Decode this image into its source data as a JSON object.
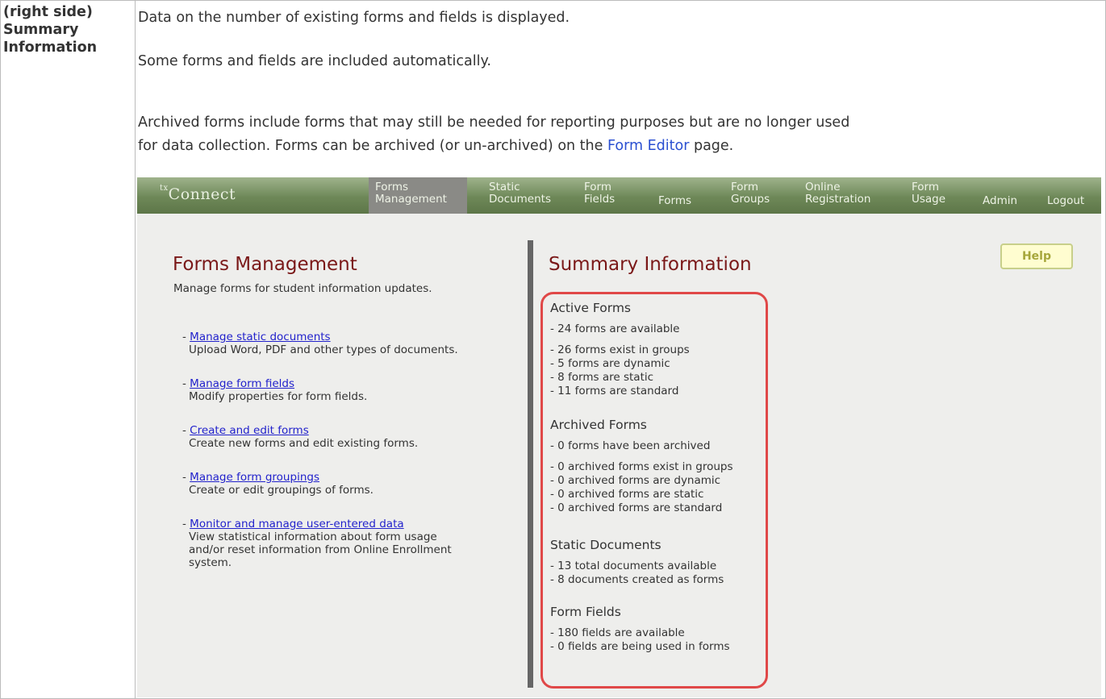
{
  "doc": {
    "cell_header_lines": [
      "(right side)",
      "Summary",
      "Information"
    ],
    "para1": "Data on the number of existing forms and fields is displayed.",
    "para2": "Some forms and fields are included automatically.",
    "para3_line1": "Archived forms include forms that may still be needed for reporting purposes but are no longer used",
    "para3_line2_prefix": "for data collection. Forms can be archived (or un-archived) on the ",
    "para3_link": "Form Editor",
    "para3_line2_suffix": " page."
  },
  "app": {
    "logo_prefix": "tx",
    "logo_text": "Connect",
    "nav": [
      {
        "line1": "Forms",
        "line2": "Management"
      },
      {
        "line1": "Static",
        "line2": "Documents"
      },
      {
        "line1": "Form",
        "line2": "Fields"
      },
      {
        "line1": "",
        "line2": "Forms"
      },
      {
        "line1": "Form",
        "line2": "Groups"
      },
      {
        "line1": "Online",
        "line2": "Registration"
      },
      {
        "line1": "Form",
        "line2": "Usage"
      },
      {
        "line1": "",
        "line2": "Admin"
      },
      {
        "line1": "",
        "line2": "Logout"
      }
    ],
    "forms_management": {
      "title": "Forms Management",
      "subtitle": "Manage forms for student information updates.",
      "items": [
        {
          "link": "Manage static documents",
          "desc": [
            "Upload Word, PDF and other types of documents."
          ]
        },
        {
          "link": "Manage form fields",
          "desc": [
            "Modify properties for form fields."
          ]
        },
        {
          "link": "Create and edit forms",
          "desc": [
            "Create new forms and edit existing forms."
          ]
        },
        {
          "link": "Manage form groupings",
          "desc": [
            "Create or edit groupings of forms."
          ]
        },
        {
          "link": "Monitor and manage user-entered data",
          "desc": [
            "View statistical information about form usage",
            "and/or reset information from Online Enrollment",
            "system."
          ]
        }
      ]
    },
    "summary": {
      "title": "Summary Information",
      "help_label": "Help",
      "sections": [
        {
          "heading": "Active Forms",
          "lines": [
            "- 24 forms are available",
            "- 26 forms exist in groups",
            "- 5 forms are dynamic",
            "- 8 forms are static",
            "- 11 forms are standard"
          ]
        },
        {
          "heading": "Archived Forms",
          "lines": [
            "- 0 forms have been archived",
            "- 0 archived forms exist in groups",
            "- 0 archived forms are dynamic",
            "- 0 archived forms are static",
            "- 0 archived forms are standard"
          ]
        },
        {
          "heading": "Static Documents",
          "lines": [
            "- 13 total documents available",
            "- 8 documents created as forms"
          ]
        },
        {
          "heading": "Form Fields",
          "lines": [
            "- 180 fields are available",
            "- 0 fields are being used in forms"
          ]
        }
      ]
    }
  }
}
